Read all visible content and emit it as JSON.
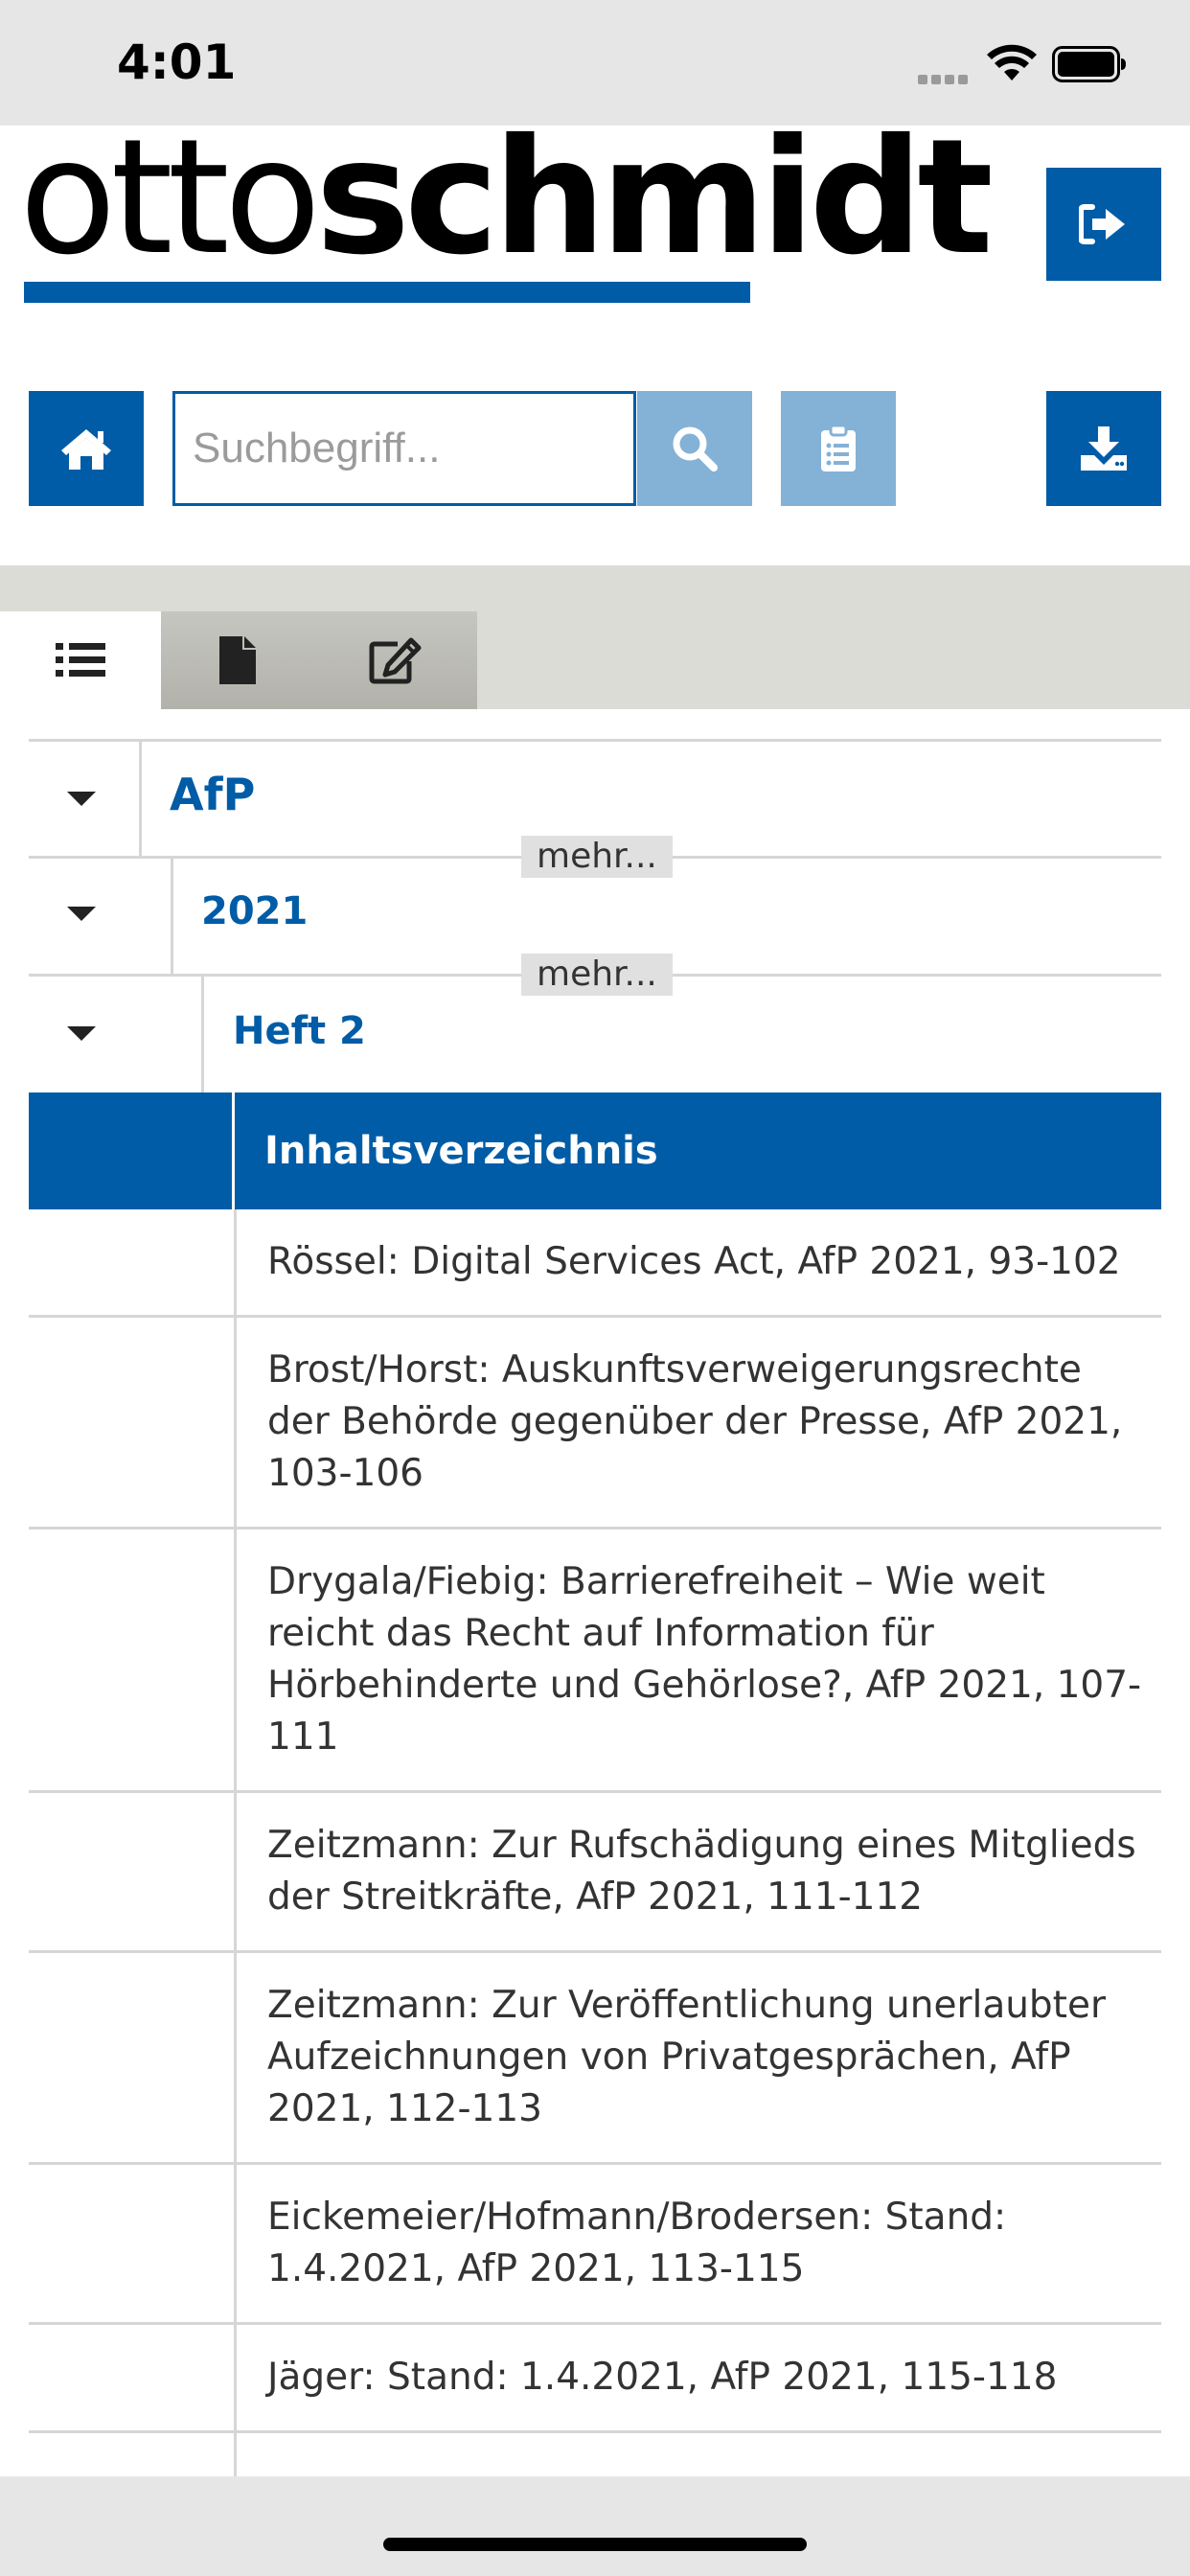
{
  "status_bar": {
    "time": "4:01"
  },
  "header": {
    "logo": {
      "part_light": "otto",
      "part_bold": "schmidt"
    },
    "search_placeholder": "Suchbegriff..."
  },
  "icons": {
    "logout": "sign-out-icon",
    "home": "home-icon",
    "search": "search-icon",
    "clipboard": "clipboard-list-icon",
    "download": "download-icon",
    "list": "list-icon",
    "document": "document-icon",
    "edit": "edit-icon"
  },
  "colors": {
    "brand": "#005ca6",
    "brand_light": "#84b1d6",
    "tab_strip": "#dcdcd6",
    "badge": "#e0e0e0"
  },
  "tree": {
    "level1": {
      "label": "AfP",
      "more": "mehr..."
    },
    "level2": {
      "label": "2021",
      "more": "mehr..."
    },
    "level3": {
      "label": "Heft 2"
    }
  },
  "toc": {
    "title": "Inhaltsverzeichnis",
    "entries": [
      "Rössel: Digital Services Act, AfP 2021, 93-102",
      "Brost/Horst: Auskunftsverweigerungsrechte der Behörde gegenüber der Presse, AfP 2021, 103-106",
      "Drygala/Fiebig: Barrierefreiheit – Wie weit reicht das Recht auf Information für Hörbehinderte und Gehörlose?, AfP 2021, 107-111",
      "Zeitzmann: Zur Rufschädigung eines Mitglieds der Streitkräfte, AfP 2021, 111-112",
      "Zeitzmann: Zur Veröffentlichung unerlaubter Aufzeichnungen von Privatgesprächen, AfP 2021, 112-113",
      "Eickemeier/Hofmann/Brodersen: Stand: 1.4.2021, AfP 2021, 113-115",
      "Jäger: Stand: 1.4.2021, AfP 2021, 115-118"
    ]
  }
}
